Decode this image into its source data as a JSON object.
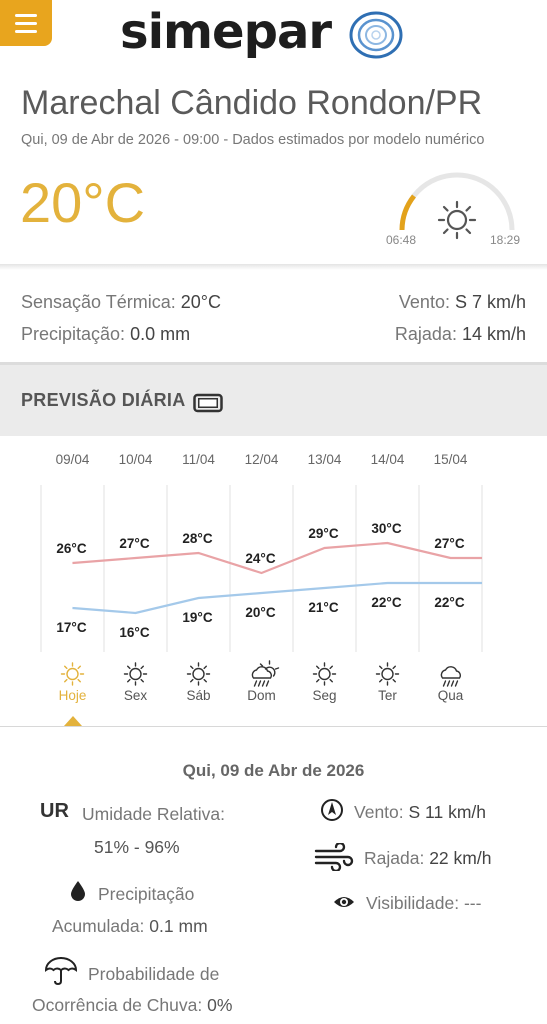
{
  "header": {
    "brand": "simepar"
  },
  "location": {
    "city": "Marechal Cândido Rondon/PR",
    "subtitle": "Qui, 09 de Abr de 2026 - 09:00 - Dados estimados por modelo numérico",
    "temperature": "20°C"
  },
  "sun": {
    "sunrise": "06:48",
    "sunset": "18:29",
    "icon": "sun-icon"
  },
  "current": {
    "feels_like_label": "Sensação Térmica:",
    "feels_like_value": "20°C",
    "precip_label": "Precipitação:",
    "precip_value": "0.0 mm",
    "wind_label": "Vento:",
    "wind_value": "S 7 km/h",
    "gust_label": "Rajada:",
    "gust_value": "14 km/h"
  },
  "daily": {
    "title": "PREVISÃO DIÁRIA"
  },
  "chart_data": {
    "type": "line",
    "x": [
      "09/04",
      "10/04",
      "11/04",
      "12/04",
      "13/04",
      "14/04",
      "15/04"
    ],
    "series": [
      {
        "values": [
          26,
          27,
          28,
          24,
          29,
          30,
          27
        ],
        "color": "#e9a3a6"
      },
      {
        "values": [
          17,
          16,
          19,
          20,
          21,
          22,
          22
        ],
        "color": "#a4c9ea"
      }
    ],
    "max_labels": [
      "26°C",
      "27°C",
      "28°C",
      "24°C",
      "29°C",
      "30°C",
      "27°C"
    ],
    "min_labels": [
      "17°C",
      "16°C",
      "19°C",
      "20°C",
      "21°C",
      "22°C",
      "22°C"
    ],
    "day_names": [
      "Hoje",
      "Sex",
      "Sáb",
      "Dom",
      "Seg",
      "Ter",
      "Qua"
    ],
    "day_icons": [
      "sun-icon",
      "sun-icon",
      "sun-icon",
      "sun-rain-icon",
      "sun-icon",
      "sun-icon",
      "rain-cloud-icon"
    ],
    "selected_index": 0
  },
  "details": {
    "date": "Qui, 09 de Abr de 2026",
    "ur_tag": "UR",
    "humidity_label": "Umidade Relativa:",
    "humidity_value": "51% - 96%",
    "precip_label": "Precipitação",
    "precip_acc_label": "Acumulada:",
    "precip_acc_value": "0.1 mm",
    "prob_label": "Probabilidade de",
    "prob_occ_label": "Ocorrência de Chuva:",
    "prob_value": "0%",
    "wind_label": "Vento:",
    "wind_value": "S 11 km/h",
    "gust_label": "Rajada:",
    "gust_value": "22 km/h",
    "visibility_label": "Visibilidade:",
    "visibility_value": "---"
  },
  "colors": {
    "accent": "#e3b23c",
    "menu": "#e8a51e",
    "max_line": "#e9a3a6",
    "min_line": "#a4c9ea",
    "logo_blue": "#2f6fb3"
  }
}
